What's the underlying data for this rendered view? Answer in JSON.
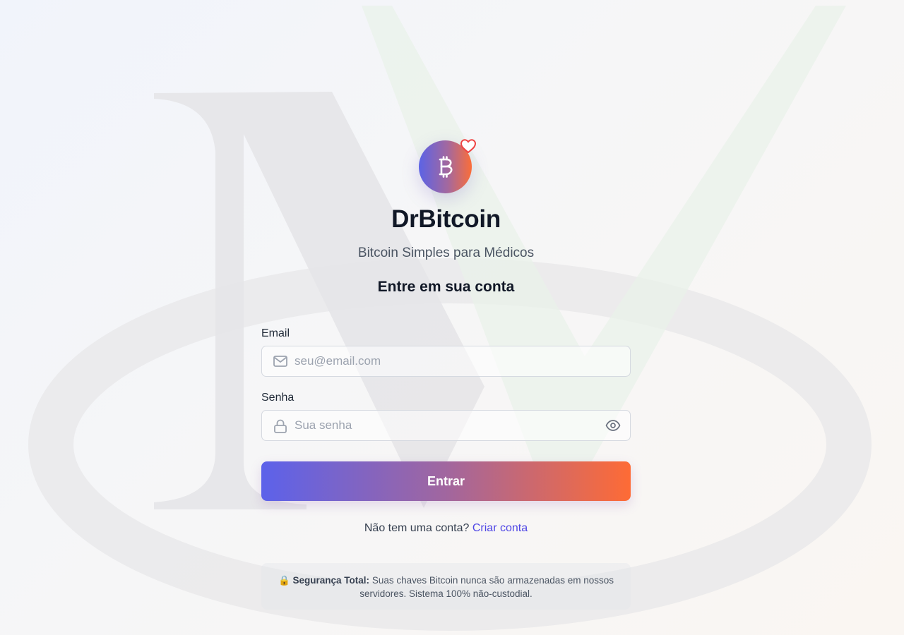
{
  "brand": {
    "name": "DrBitcoin",
    "tagline": "Bitcoin Simples para Médicos",
    "logo_icon": "bitcoin-icon",
    "badge_icon": "heart-icon"
  },
  "form": {
    "title": "Entre em sua conta",
    "email": {
      "label": "Email",
      "placeholder": "seu@email.com",
      "value": "",
      "icon": "mail-icon"
    },
    "password": {
      "label": "Senha",
      "placeholder": "Sua senha",
      "value": "",
      "icon": "lock-icon",
      "toggle_icon": "eye-icon"
    },
    "submit_label": "Entrar"
  },
  "signup": {
    "prompt": "Não tem uma conta?",
    "link_label": "Criar conta"
  },
  "security": {
    "icon": "lock-emoji",
    "title": "Segurança Total:",
    "text": "Suas chaves Bitcoin nunca são armazenadas em nossos servidores. Sistema 100% não-custodial."
  },
  "colors": {
    "primary_start": "#5c62ea",
    "primary_end": "#fe6b35",
    "link": "#4f46e5",
    "heart": "#ef4444"
  }
}
